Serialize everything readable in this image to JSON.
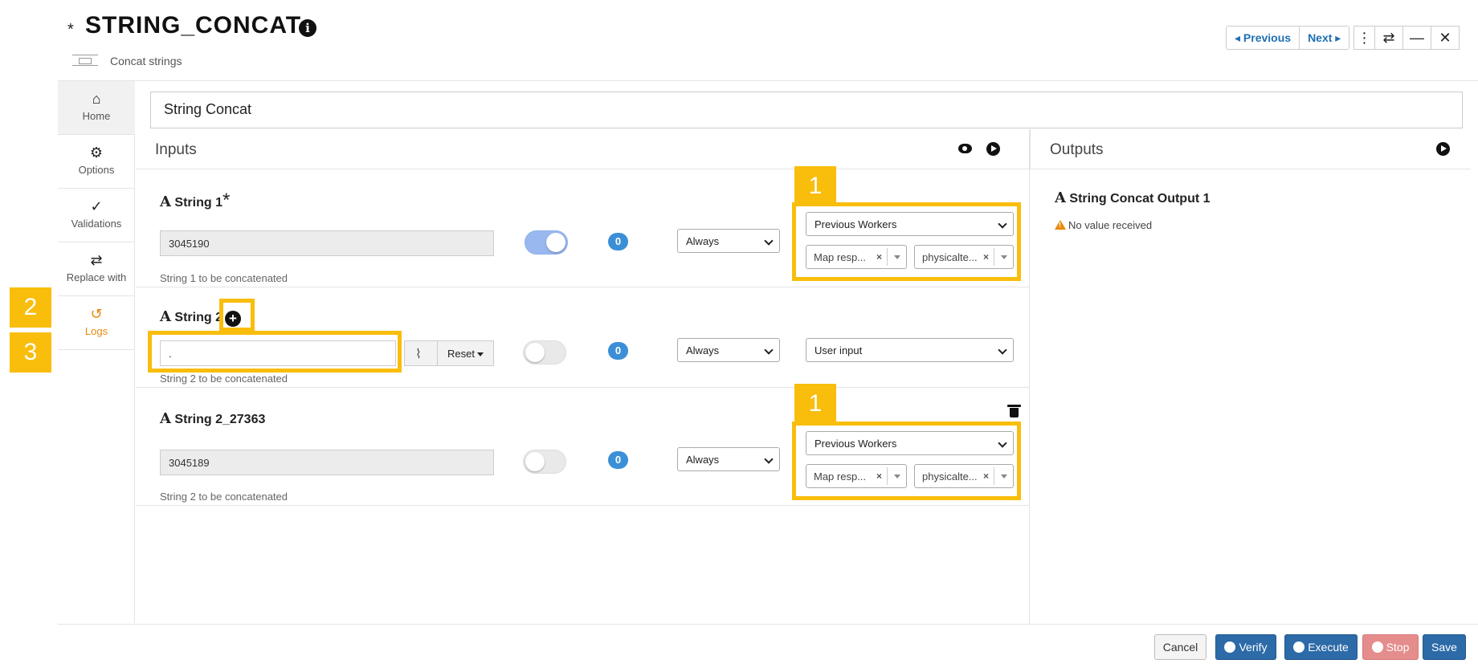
{
  "header": {
    "modified_marker": "*",
    "title": "STRING_CONCAT",
    "subtitle": "Concat strings",
    "previous_label": "Previous",
    "next_label": "Next"
  },
  "sidebar": {
    "items": [
      {
        "label": "Home",
        "icon": "home-icon"
      },
      {
        "label": "Options",
        "icon": "gear-icon"
      },
      {
        "label": "Validations",
        "icon": "check-double-icon"
      },
      {
        "label": "Replace with",
        "icon": "exchange-icon"
      },
      {
        "label": "Logs",
        "icon": "history-icon",
        "active_color": "#e8890c"
      }
    ]
  },
  "worker_name": "String Concat",
  "inputs": {
    "title": "Inputs",
    "fields": [
      {
        "label": "String 1",
        "required_marker": "*",
        "value": "3045190",
        "hint": "String 1 to be concatenated",
        "toggle_on": true,
        "badge": "0",
        "condition": "Always",
        "source": "Previous Workers",
        "chip1": "Map resp...",
        "chip2": "physicalte..."
      },
      {
        "label": "String 2",
        "value": ".",
        "hint": "String 2 to be concatenated",
        "toggle_on": false,
        "badge": "0",
        "condition": "Always",
        "source": "User input",
        "reset_label": "Reset"
      },
      {
        "label": "String 2_27363",
        "value": "3045189",
        "hint": "String 2 to be concatenated",
        "toggle_on": false,
        "badge": "0",
        "condition": "Always",
        "source": "Previous Workers",
        "chip1": "Map resp...",
        "chip2": "physicalte..."
      }
    ]
  },
  "outputs": {
    "title": "Outputs",
    "items": [
      {
        "label": "String Concat Output 1",
        "status": "No value received"
      }
    ]
  },
  "type_glyph": "A",
  "markers": [
    "1",
    "2",
    "3",
    "1"
  ],
  "footer": {
    "cancel": "Cancel",
    "verify": "Verify",
    "execute": "Execute",
    "stop": "Stop",
    "save": "Save"
  },
  "colors": {
    "highlight": "#f9bd0c",
    "primary": "#2c6aa8",
    "stop": "#e58c8c",
    "badge": "#3b8fd6"
  }
}
